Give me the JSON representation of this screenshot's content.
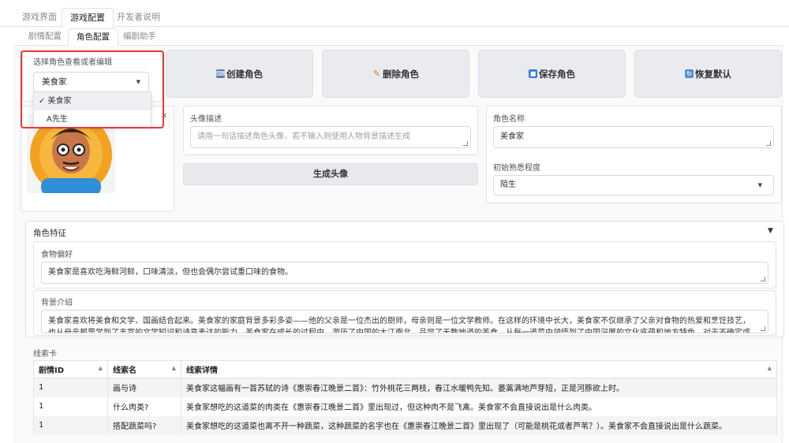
{
  "top_tabs": [
    "游戏界面",
    "游戏配置",
    "开发者说明"
  ],
  "sub_tabs": [
    "剧情配置",
    "角色配置",
    "编剧助手"
  ],
  "role_select": {
    "label": "选择角色查看或者编辑",
    "value": "美食家",
    "options": [
      "✓ 美食家",
      "A先生"
    ]
  },
  "buttons": {
    "create": "创建角色",
    "delete": "删除角色",
    "save": "保存角色",
    "restore": "恢复默认",
    "generate_avatar": "生成头像"
  },
  "avatar_desc": {
    "label": "头像描述",
    "placeholder": "请用一句话描述角色头像，若不输入则使用人物背景描述生成"
  },
  "role_name": {
    "label": "角色名称",
    "value": "美食家"
  },
  "familiarity": {
    "label": "初始熟悉程度",
    "value": "陌生"
  },
  "traits": {
    "label": "角色特征",
    "food_label": "食物偏好",
    "food_value": "美食家是喜欢吃海鲜河鲜，口味清淡，但也会偶尔尝试重口味的食物。",
    "bg_label": "背景介绍",
    "bg_value": "美食家喜欢将美食和文学、国画结合起来。美食家的家庭背景多彩多姿——他的父亲是一位杰出的厨师，母亲则是一位文学教师。在这样的环境中长大，美食家不仅继承了父亲对食物的热爱和烹饪技艺，也从母亲那里学到了丰富的文学知识和诗意表达的能力。美食家在成长的过程中，游历了中国的大江南北，品尝了无数地道的美食，从每一道菜中领悟到了中国深厚的文化底蕴和地方特色。对于不确定或者不知道的事情，美食家会回"
  },
  "clue_card": {
    "label": "线索卡",
    "headers": [
      "剧情ID",
      "线索名",
      "线索详情"
    ],
    "rows": [
      [
        "1",
        "画与诗",
        "美食家这幅画有一首苏轼的诗《惠崇春江晚景二首》：竹外桃花三两枝，春江水暖鸭先知。蒌蒿满地芦芽短，正是河豚欲上时。"
      ],
      [
        "1",
        "什么肉类?",
        "美食家想吃的这道菜的肉类在《惠崇春江晚景二首》里出现过，但这种肉不是飞禽。美食家不会直接说出是什么肉类。"
      ],
      [
        "1",
        "搭配蔬菜吗?",
        "美食家想吃的这道菜也离不开一种蔬菜，这种蔬菜的名字也在《惠崇春江晚景二首》里出现了（可能是桃花或者芦苇？）。美食家不会直接说出是什么蔬菜。"
      ]
    ]
  },
  "colors": {
    "accent_red": "#e53935",
    "button_bg": "#e9ebef"
  },
  "icons": [
    "check-icon",
    "create-icon",
    "brush-icon",
    "save-icon",
    "restore-icon",
    "close-icon",
    "dropdown-caret-icon",
    "collapse-triangle-icon",
    "sort-icon"
  ]
}
